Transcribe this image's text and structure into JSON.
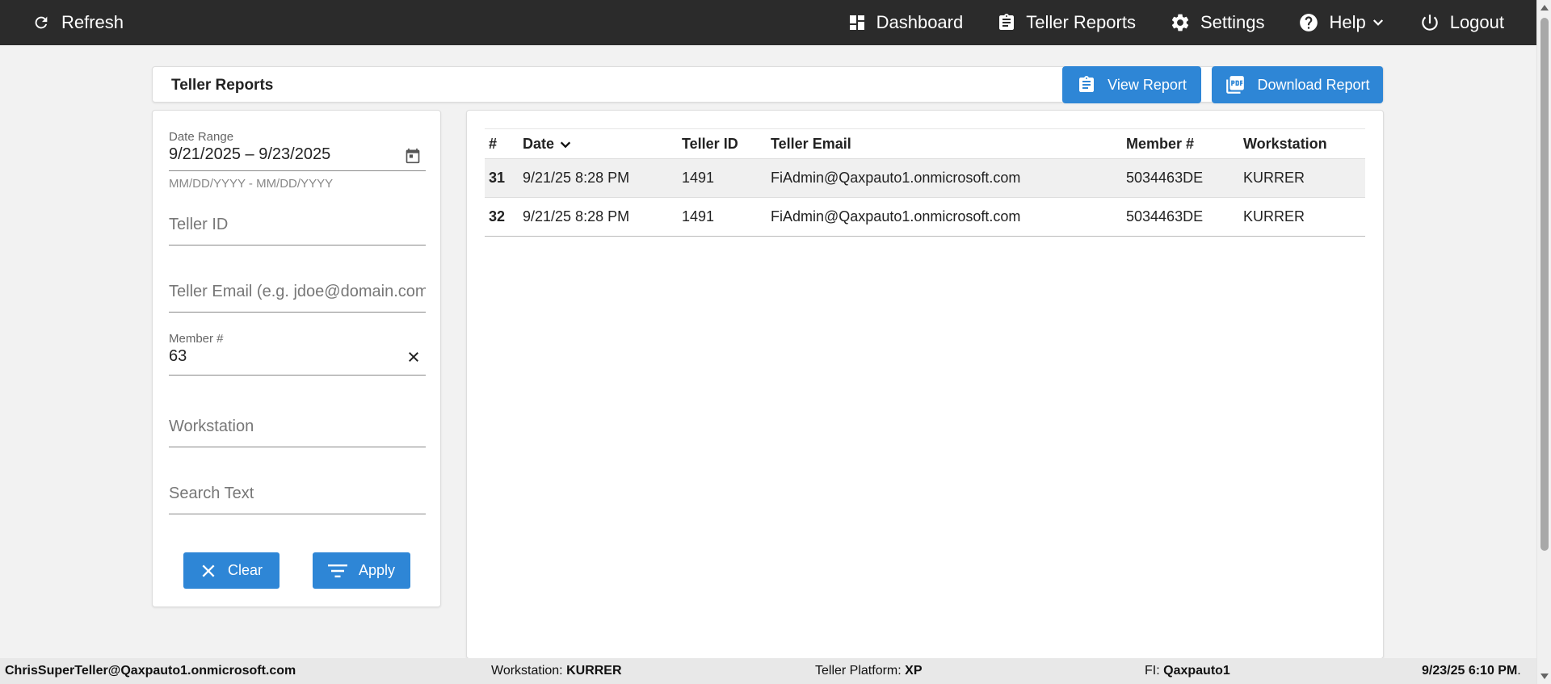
{
  "topbar": {
    "refresh_label": "Refresh",
    "nav": [
      {
        "label": "Dashboard",
        "icon": "dashboard-icon"
      },
      {
        "label": "Teller Reports",
        "icon": "clipboard-icon"
      },
      {
        "label": "Settings",
        "icon": "gear-icon"
      },
      {
        "label": "Help",
        "icon": "help-icon"
      },
      {
        "label": "Logout",
        "icon": "power-icon"
      }
    ]
  },
  "page": {
    "title": "Teller Reports",
    "view_report_label": "View Report",
    "download_report_label": "Download Report"
  },
  "filters": {
    "date_range_label": "Date Range",
    "date_range_value": "9/21/2025 – 9/23/2025",
    "date_range_hint": "MM/DD/YYYY - MM/DD/YYYY",
    "teller_id_placeholder": "Teller ID",
    "teller_email_placeholder": "Teller Email (e.g. jdoe@domain.com)",
    "member_label": "Member #",
    "member_value": "63",
    "workstation_placeholder": "Workstation",
    "search_text_placeholder": "Search Text",
    "clear_label": "Clear",
    "apply_label": "Apply"
  },
  "table": {
    "columns": [
      "#",
      "Date",
      "Teller ID",
      "Teller Email",
      "Member #",
      "Workstation"
    ],
    "rows": [
      {
        "num": "31",
        "date": "9/21/25 8:28 PM",
        "teller_id": "1491",
        "email": "FiAdmin@Qaxpauto1.onmicrosoft.com",
        "member": "5034463DE",
        "workstation": "KURRER"
      },
      {
        "num": "32",
        "date": "9/21/25 8:28 PM",
        "teller_id": "1491",
        "email": "FiAdmin@Qaxpauto1.onmicrosoft.com",
        "member": "5034463DE",
        "workstation": "KURRER"
      }
    ]
  },
  "status": {
    "user": "ChrisSuperTeller@Qaxpauto1.onmicrosoft.com",
    "workstation_label": "Workstation:",
    "workstation_value": "KURRER",
    "platform_label": "Teller Platform:",
    "platform_value": "XP",
    "fi_label": "FI:",
    "fi_value": "Qaxpauto1",
    "datetime": "9/23/25 6:10 PM",
    "datetime_suffix": "."
  },
  "colors": {
    "topbar": "#2b2b2b",
    "accent": "#2e86d6",
    "background": "#f2f2f2"
  }
}
